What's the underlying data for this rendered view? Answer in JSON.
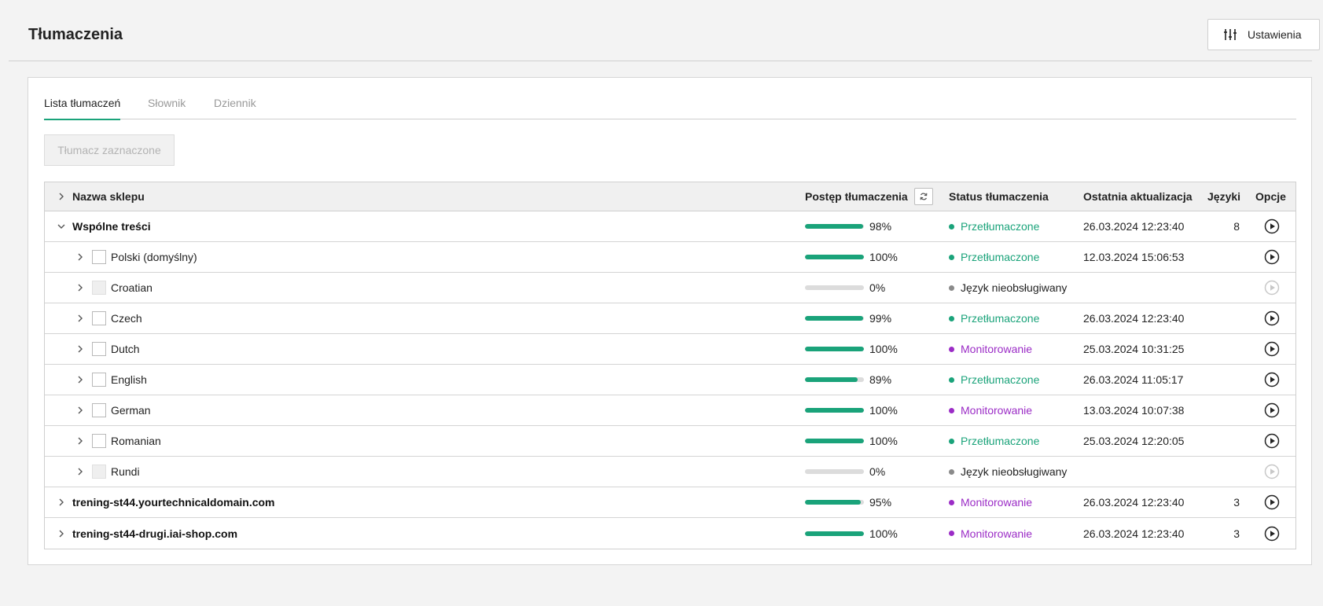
{
  "header": {
    "title": "Tłumaczenia",
    "settings_label": "Ustawienia"
  },
  "tabs": [
    {
      "label": "Lista tłumaczeń",
      "active": true
    },
    {
      "label": "Słownik",
      "active": false
    },
    {
      "label": "Dziennik",
      "active": false
    }
  ],
  "translate_button": "Tłumacz zaznaczone",
  "columns": {
    "name": "Nazwa sklepu",
    "progress": "Postęp tłumaczenia",
    "status": "Status tłumaczenia",
    "updated": "Ostatnia aktualizacja",
    "languages": "Języki",
    "options": "Opcje"
  },
  "colors": {
    "accent": "#1aa37a",
    "translated": "#1aa37a",
    "monitoring": "#9b2cc6",
    "unsupported": "#8a8a8a",
    "bar_empty": "#dcdcdc"
  },
  "rows": [
    {
      "level": 0,
      "expanded": true,
      "name": "Wspólne treści",
      "checkbox": "none",
      "progress": 98,
      "progress_label": "98%",
      "status": "Przetłumaczone",
      "status_type": "translated",
      "updated": "26.03.2024 12:23:40",
      "languages": "8",
      "play_enabled": true
    },
    {
      "level": 1,
      "expanded": false,
      "name": "Polski (domyślny)",
      "checkbox": "enabled",
      "progress": 100,
      "progress_label": "100%",
      "status": "Przetłumaczone",
      "status_type": "translated",
      "updated": "12.03.2024 15:06:53",
      "languages": "",
      "play_enabled": true
    },
    {
      "level": 1,
      "expanded": false,
      "name": "Croatian",
      "checkbox": "disabled",
      "progress": 0,
      "progress_label": "0%",
      "status": "Język nieobsługiwany",
      "status_type": "unsupported",
      "updated": "",
      "languages": "",
      "play_enabled": false
    },
    {
      "level": 1,
      "expanded": false,
      "name": "Czech",
      "checkbox": "enabled",
      "progress": 99,
      "progress_label": "99%",
      "status": "Przetłumaczone",
      "status_type": "translated",
      "updated": "26.03.2024 12:23:40",
      "languages": "",
      "play_enabled": true
    },
    {
      "level": 1,
      "expanded": false,
      "name": "Dutch",
      "checkbox": "enabled",
      "progress": 100,
      "progress_label": "100%",
      "status": "Monitorowanie",
      "status_type": "monitoring",
      "updated": "25.03.2024 10:31:25",
      "languages": "",
      "play_enabled": true
    },
    {
      "level": 1,
      "expanded": false,
      "name": "English",
      "checkbox": "enabled",
      "progress": 89,
      "progress_label": "89%",
      "status": "Przetłumaczone",
      "status_type": "translated",
      "updated": "26.03.2024 11:05:17",
      "languages": "",
      "play_enabled": true
    },
    {
      "level": 1,
      "expanded": false,
      "name": "German",
      "checkbox": "enabled",
      "progress": 100,
      "progress_label": "100%",
      "status": "Monitorowanie",
      "status_type": "monitoring",
      "updated": "13.03.2024 10:07:38",
      "languages": "",
      "play_enabled": true
    },
    {
      "level": 1,
      "expanded": false,
      "name": "Romanian",
      "checkbox": "enabled",
      "progress": 100,
      "progress_label": "100%",
      "status": "Przetłumaczone",
      "status_type": "translated",
      "updated": "25.03.2024 12:20:05",
      "languages": "",
      "play_enabled": true
    },
    {
      "level": 1,
      "expanded": false,
      "name": "Rundi",
      "checkbox": "disabled",
      "progress": 0,
      "progress_label": "0%",
      "status": "Język nieobsługiwany",
      "status_type": "unsupported",
      "updated": "",
      "languages": "",
      "play_enabled": false
    },
    {
      "level": 0,
      "expanded": false,
      "name": "trening-st44.yourtechnicaldomain.com",
      "checkbox": "none",
      "progress": 95,
      "progress_label": "95%",
      "status": "Monitorowanie",
      "status_type": "monitoring",
      "updated": "26.03.2024 12:23:40",
      "languages": "3",
      "play_enabled": true
    },
    {
      "level": 0,
      "expanded": false,
      "name": "trening-st44-drugi.iai-shop.com",
      "checkbox": "none",
      "progress": 100,
      "progress_label": "100%",
      "status": "Monitorowanie",
      "status_type": "monitoring",
      "updated": "26.03.2024 12:23:40",
      "languages": "3",
      "play_enabled": true
    }
  ]
}
